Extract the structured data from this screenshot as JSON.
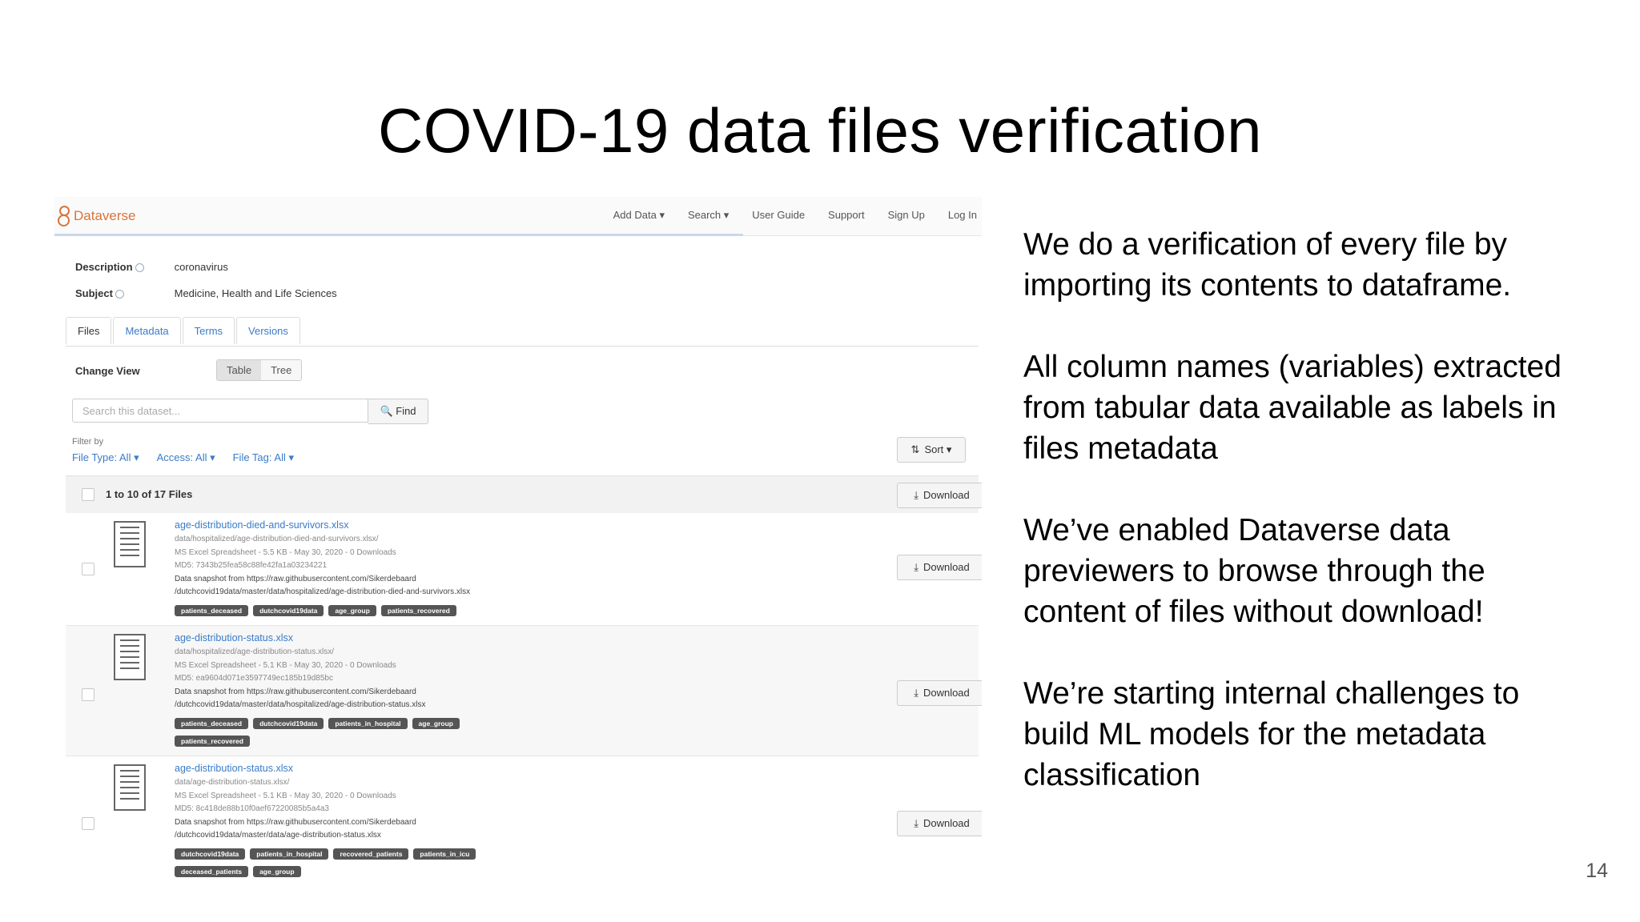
{
  "slide": {
    "title": "COVID-19 data files verification",
    "page_number": "14",
    "bullets": [
      "We do a verification of every file by importing its contents to dataframe.",
      "All column names (variables) extracted from tabular data available as labels in files metadata",
      "We’ve enabled Dataverse data previewers to browse through the content of files without download!",
      "We’re starting internal challenges to build ML models for the metadata classification"
    ]
  },
  "app": {
    "brand": "Dataverse",
    "nav": [
      "Add Data ▾",
      "Search ▾",
      "User Guide",
      "Support",
      "Sign Up",
      "Log In"
    ],
    "description_label": "Description",
    "description_value": "coronavirus",
    "subject_label": "Subject",
    "subject_value": "Medicine, Health and Life Sciences",
    "tabs": [
      "Files",
      "Metadata",
      "Terms",
      "Versions"
    ],
    "change_view_label": "Change View",
    "view_options": [
      "Table",
      "Tree"
    ],
    "search_placeholder": "Search this dataset...",
    "find_label": "Find",
    "filter_by_label": "Filter by",
    "filters": [
      "File Type: All ▾",
      "Access: All ▾",
      "File Tag: All ▾"
    ],
    "sort_label": "Sort ▾",
    "files_count": "1 to 10 of 17 Files",
    "download_label": "Download",
    "files": [
      {
        "name": "age-distribution-died-and-survivors.xlsx",
        "path": "data/hospitalized/age-distribution-died-and-survivors.xlsx/",
        "info": "MS Excel Spreadsheet - 5.5 KB - May 30, 2020 - 0 Downloads",
        "md5": "MD5: 7343b25fea58c88fe42fa1a03234221",
        "snapshot_1": "Data snapshot from https://raw.githubusercontent.com/Sikerdebaard",
        "snapshot_2": "/dutchcovid19data/master/data/hospitalized/age-distribution-died-and-survivors.xlsx",
        "tags": [
          "patients_deceased",
          "dutchcovid19data",
          "age_group",
          "patients_recovered"
        ]
      },
      {
        "name": "age-distribution-status.xlsx",
        "path": "data/hospitalized/age-distribution-status.xlsx/",
        "info": "MS Excel Spreadsheet - 5.1 KB - May 30, 2020 - 0 Downloads",
        "md5": "MD5: ea9604d071e3597749ec185b19d85bc",
        "snapshot_1": "Data snapshot from https://raw.githubusercontent.com/Sikerdebaard",
        "snapshot_2": "/dutchcovid19data/master/data/hospitalized/age-distribution-status.xlsx",
        "tags": [
          "patients_deceased",
          "dutchcovid19data",
          "patients_in_hospital",
          "age_group",
          "patients_recovered"
        ]
      },
      {
        "name": "age-distribution-status.xlsx",
        "path": "data/age-distribution-status.xlsx/",
        "info": "MS Excel Spreadsheet - 5.1 KB - May 30, 2020 - 0 Downloads",
        "md5": "MD5: 8c418de88b10f0aef67220085b5a4a3",
        "snapshot_1": "Data snapshot from https://raw.githubusercontent.com/Sikerdebaard",
        "snapshot_2": "/dutchcovid19data/master/data/age-distribution-status.xlsx",
        "tags": [
          "dutchcovid19data",
          "patients_in_hospital",
          "recovered_patients",
          "patients_in_icu",
          "deceased_patients",
          "age_group"
        ]
      }
    ]
  }
}
